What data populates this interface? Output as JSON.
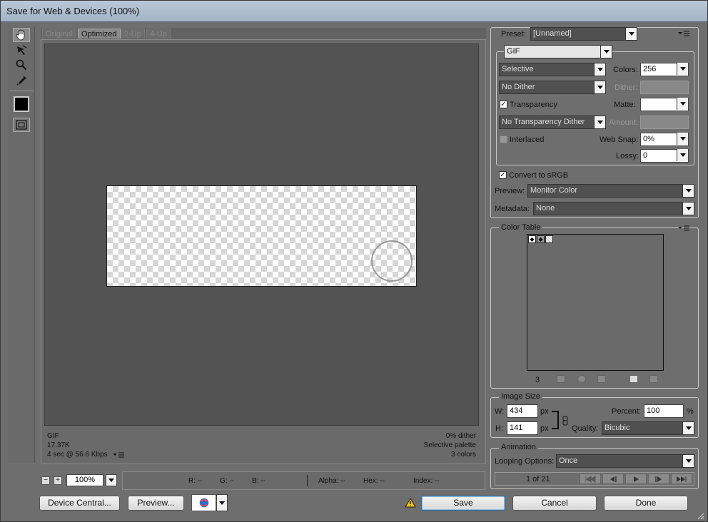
{
  "window": {
    "title": "Save for Web & Devices (100%)"
  },
  "tabs": [
    {
      "label": "Original",
      "active": false
    },
    {
      "label": "Optimized",
      "active": true
    },
    {
      "label": "2-Up",
      "active": false
    },
    {
      "label": "4-Up",
      "active": false
    }
  ],
  "tools": [
    "hand-tool-icon",
    "slice-select-icon",
    "zoom-tool-icon",
    "eyedropper-tool-icon",
    "eyedropper-color-swatch-icon",
    "toggle-slices-icon"
  ],
  "info_left": {
    "format": "GIF",
    "size": "17.37K",
    "time": "4 sec @ 56.6 Kbps"
  },
  "info_right": {
    "dither": "0% dither",
    "palette": "Selective palette",
    "colors": "3 colors"
  },
  "zoom": {
    "minus": "−",
    "plus": "+",
    "value": "100%"
  },
  "readouts": {
    "r": "R: --",
    "g": "G: --",
    "b": "B: --",
    "alpha": "Alpha: --",
    "hex": "Hex: --",
    "index": "Index: --"
  },
  "bottom_buttons": {
    "device_central": "Device Central...",
    "preview": "Preview...",
    "save": "Save",
    "cancel": "Cancel",
    "done": "Done"
  },
  "settings": {
    "preset_label": "Preset:",
    "preset_value": "[Unnamed]",
    "format": "GIF",
    "reduction": "Selective",
    "colors_label": "Colors:",
    "colors_value": "256",
    "dither_algo": "No Dither",
    "dither_label": "Dither:",
    "transparency_label": "Transparency",
    "transparency_checked": true,
    "matte_label": "Matte:",
    "transparency_dither": "No Transparency Dither",
    "amount_label": "Amount:",
    "interlaced_label": "Interlaced",
    "interlaced_checked": false,
    "websnap_label": "Web Snap:",
    "websnap_value": "0%",
    "lossy_label": "Lossy:",
    "lossy_value": "0",
    "convert_srgb_label": "Convert to sRGB",
    "convert_srgb_checked": true,
    "preview_label": "Preview:",
    "preview_value": "Monitor Color",
    "metadata_label": "Metadata:",
    "metadata_value": "None"
  },
  "color_table": {
    "title": "Color Table",
    "count": "3"
  },
  "image_size": {
    "title": "Image Size",
    "w_label": "W:",
    "w_value": "434",
    "w_unit": "px",
    "h_label": "H:",
    "h_value": "141",
    "h_unit": "px",
    "percent_label": "Percent:",
    "percent_value": "100",
    "percent_unit": "%",
    "quality_label": "Quality:",
    "quality_value": "Bicubic"
  },
  "animation": {
    "title": "Animation",
    "looping_label": "Looping Options:",
    "looping_value": "Once",
    "frame": "1 of 21"
  },
  "colors": {
    "panel_bg": "#6e6e6e",
    "canvas_bg": "#535353",
    "dropdown_bg": "#505050"
  }
}
